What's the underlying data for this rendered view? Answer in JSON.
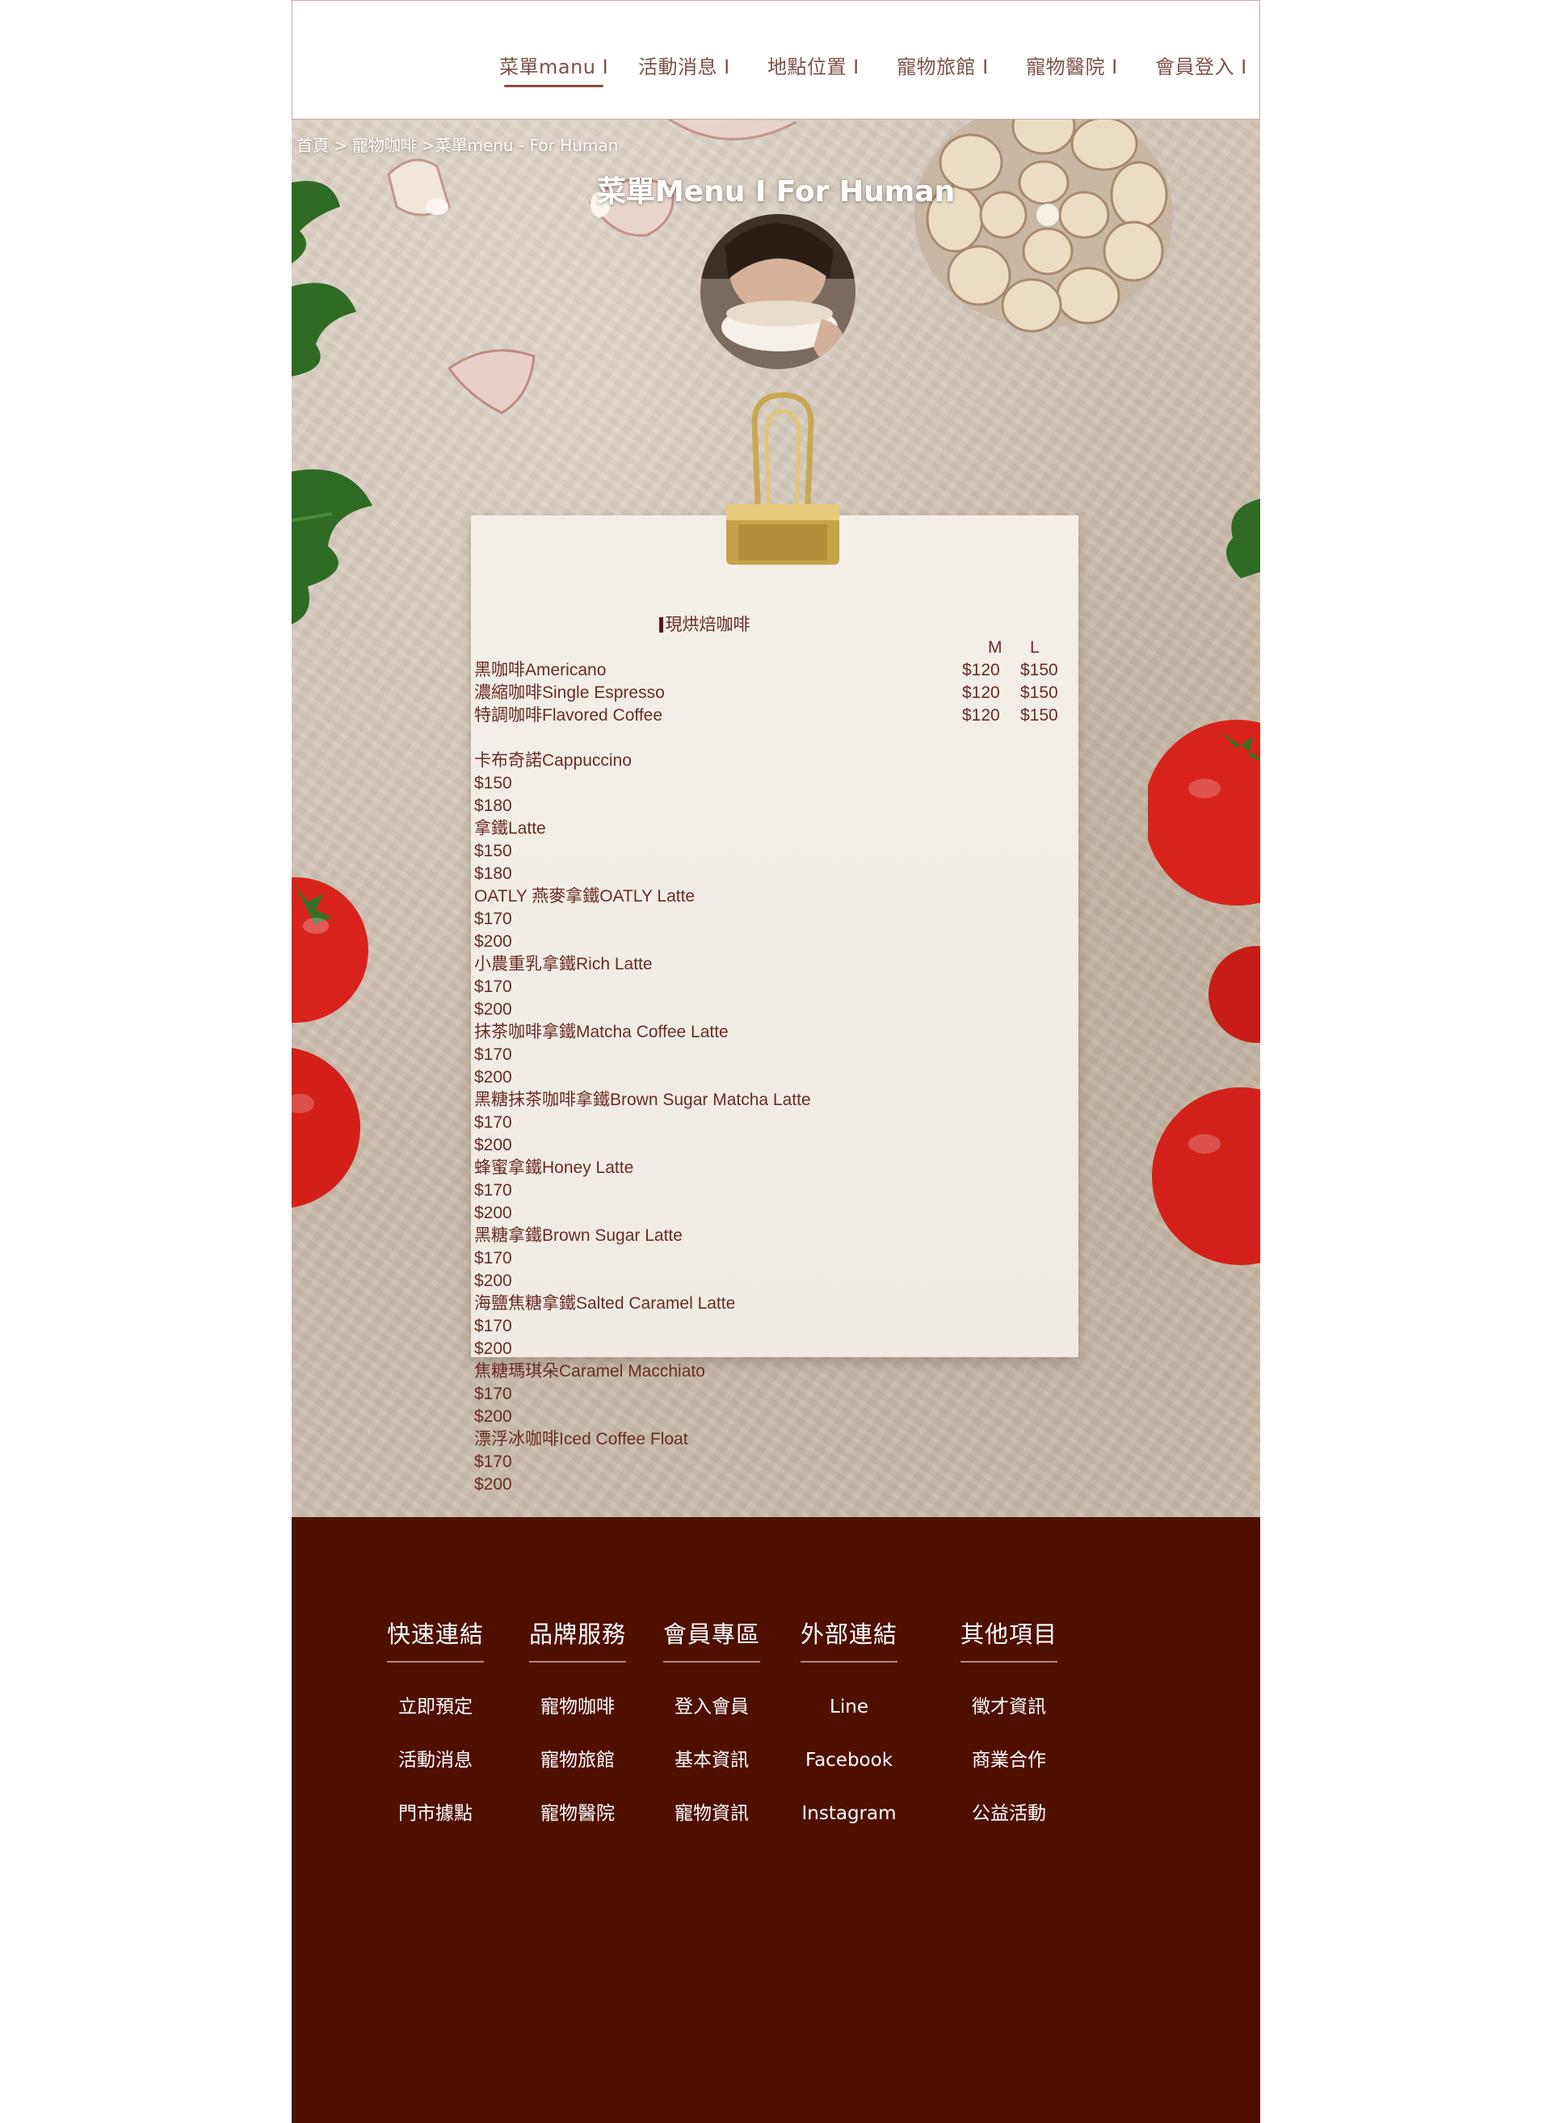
{
  "nav": {
    "items": [
      {
        "label": "菜單manu I",
        "active": true
      },
      {
        "label": "活動消息 I",
        "active": false
      },
      {
        "label": "地點位置 I",
        "active": false
      },
      {
        "label": "寵物旅館 I",
        "active": false
      },
      {
        "label": "寵物醫院 I",
        "active": false
      },
      {
        "label": "會員登入 I",
        "active": false
      }
    ]
  },
  "breadcrumb": [
    "首頁",
    ">",
    "寵物咖啡",
    ">菜單menu - For Human"
  ],
  "hero": {
    "title": "菜單Menu I  For Human"
  },
  "menu": {
    "heading": "現烘焙咖啡",
    "size_m": "M",
    "size_l": "L",
    "priced_rows": [
      {
        "name": "黑咖啡Americano",
        "m": "$120",
        "l": "$150"
      },
      {
        "name": "濃縮咖啡Single Espresso",
        "m": "$120",
        "l": "$150"
      },
      {
        "name": "特調咖啡Flavored Coffee",
        "m": "$120",
        "l": "$150"
      }
    ],
    "items": [
      {
        "name": "卡布奇諾Cappuccino",
        "m": "$150",
        "l": "$180"
      },
      {
        "name": "拿鐵Latte",
        "m": "$150",
        "l": "$180"
      },
      {
        "name": "OATLY 燕麥拿鐵OATLY Latte",
        "m": "$170",
        "l": "$200"
      },
      {
        "name": "小農重乳拿鐵Rich Latte",
        "m": "$170",
        "l": "$200"
      },
      {
        "name": "抹茶咖啡拿鐵Matcha Coffee Latte",
        "m": "$170",
        "l": "$200"
      },
      {
        "name": "黑糖抹茶咖啡拿鐵Brown Sugar Matcha Latte",
        "m": "$170",
        "l": "$200"
      },
      {
        "name": "蜂蜜拿鐵Honey Latte",
        "m": "$170",
        "l": "$200"
      },
      {
        "name": "黑糖拿鐵Brown Sugar Latte",
        "m": "$170",
        "l": "$200"
      },
      {
        "name": "海鹽焦糖拿鐵Salted Caramel Latte",
        "m": "$170",
        "l": "$200"
      },
      {
        "name": "焦糖瑪琪朵Caramel Macchiato",
        "m": "$170",
        "l": "$200"
      },
      {
        "name": "漂浮冰咖啡Iced Coffee Float",
        "m": "$170",
        "l": "$200"
      }
    ]
  },
  "footer": {
    "columns": [
      {
        "title": "快速連結",
        "links": [
          "立即預定",
          "活動消息",
          "門市據點"
        ]
      },
      {
        "title": "品牌服務",
        "links": [
          "寵物咖啡",
          "寵物旅館",
          "寵物醫院"
        ]
      },
      {
        "title": "會員專區",
        "links": [
          "登入會員",
          "基本資訊",
          "寵物資訊"
        ]
      },
      {
        "title": "外部連結",
        "links": [
          "Line",
          "Facebook",
          "Instagram"
        ]
      },
      {
        "title": "其他項目",
        "links": [
          "徵才資訊",
          "商業合作",
          "公益活動"
        ]
      }
    ]
  },
  "colors": {
    "nav_text": "#7e5048",
    "menu_text": "#6a2b22",
    "footer_bg": "#4f0f01",
    "footer_text": "#ffffff",
    "header_border": "#c9a9a4"
  },
  "icons": [
    "avatar-photo",
    "binder-clip-icon",
    "garlic-icon",
    "tomato-icon",
    "parsley-icon"
  ]
}
